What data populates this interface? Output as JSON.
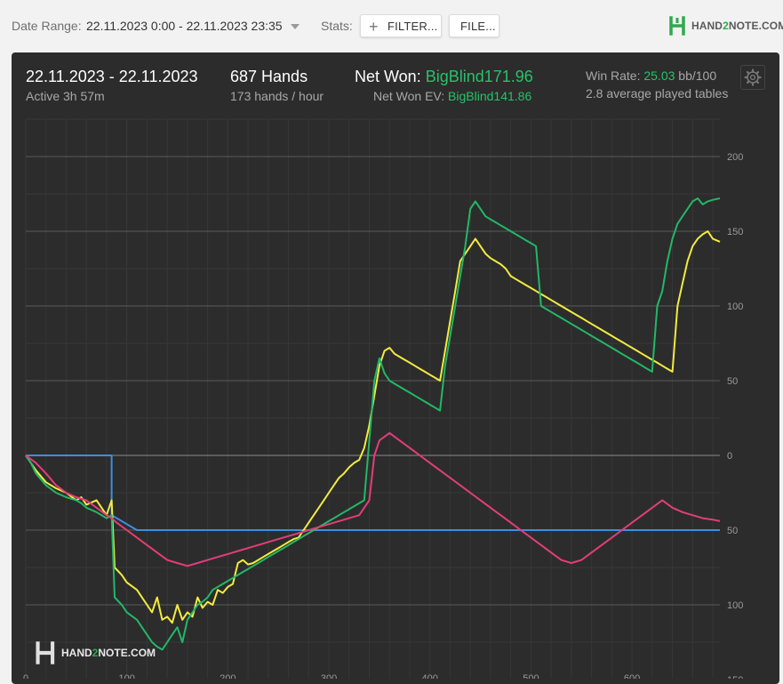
{
  "toolbar": {
    "date_range_label": "Date Range:",
    "date_range_value": "22.11.2023 0:00 - 22.11.2023 23:35",
    "stats_label": "Stats:",
    "filter_button": "FILTER...",
    "file_button": "FILE...",
    "logo_pre": "HAND",
    "logo_num": "2",
    "logo_post": "NOTE.COM"
  },
  "summary": {
    "date": "22.11.2023 - 22.11.2023",
    "active": "Active 3h 57m",
    "hands": "687 Hands",
    "hands_per_hour": "173 hands / hour",
    "net_won_label": "Net Won:",
    "net_won_value": "BigBlind171.96",
    "net_won_ev_label": "Net Won  EV:",
    "net_won_ev_value": "BigBlind141.86",
    "win_rate_label": "Win Rate:",
    "win_rate_value": "25.03",
    "win_rate_unit": "bb/100",
    "avg_tables": "2.8 average played tables"
  },
  "colors": {
    "blue": "#3d8ee0",
    "yellow": "#f2ec40",
    "green": "#22b868",
    "pink": "#e23e78",
    "panel_bg": "#2c2c2c",
    "accent_green": "#27c267"
  },
  "watermark": {
    "pre": "HAND",
    "num": "2",
    "post": "NOTE.COM"
  },
  "chart_data": {
    "type": "line",
    "x_ticks": [
      0,
      100,
      200,
      300,
      400,
      500,
      600
    ],
    "y_ticks": [
      200,
      150,
      100,
      50,
      0,
      -50,
      -100,
      -150
    ],
    "y_tick_labels": [
      "200",
      "150",
      "100",
      "50",
      "0",
      "50",
      "100",
      "150"
    ],
    "xlim": [
      0,
      687
    ],
    "ylim": [
      -150,
      225
    ],
    "grid": true,
    "series": [
      {
        "color": "#3d8ee0",
        "x": [
          0,
          85,
          85,
          110,
          110,
          155,
          155,
          190,
          190,
          210,
          210,
          236,
          236,
          272,
          272,
          295,
          296,
          305,
          305,
          330,
          330,
          343,
          345,
          350,
          350,
          360,
          360,
          400,
          400,
          412,
          412,
          420,
          420,
          448,
          455,
          455,
          460,
          460,
          475,
          480,
          480,
          495,
          495,
          500,
          510,
          510,
          580,
          585,
          585,
          600,
          600,
          615,
          615,
          625,
          625,
          665,
          665,
          675,
          675,
          687
        ],
        "y": [
          0,
          0,
          -40,
          -50,
          -50,
          -50,
          -50,
          -50,
          -50,
          -50,
          -50,
          -50,
          -50,
          -50,
          -50,
          -50,
          -50,
          -50,
          -50,
          -50,
          -50,
          -50,
          -50,
          -50,
          -50,
          -50,
          -50,
          -50,
          -50,
          -50,
          -50,
          -50,
          -50,
          -50,
          -50,
          -50,
          -50,
          -50,
          -50,
          -50,
          -50,
          -50,
          -50,
          -50,
          -50,
          -50,
          -50,
          -50,
          -50,
          -50,
          -50,
          -50,
          -50,
          -50,
          -50,
          -50,
          -50,
          -50,
          -50,
          -50
        ]
      },
      {
        "color": "#f2ec40",
        "x": [
          0,
          5,
          10,
          20,
          30,
          40,
          50,
          55,
          60,
          70,
          80,
          85,
          88,
          95,
          100,
          110,
          115,
          120,
          125,
          130,
          135,
          140,
          145,
          150,
          155,
          160,
          165,
          170,
          175,
          180,
          185,
          190,
          195,
          200,
          205,
          210,
          215,
          220,
          225,
          230,
          235,
          240,
          245,
          250,
          255,
          260,
          265,
          270,
          275,
          280,
          285,
          290,
          295,
          300,
          305,
          310,
          315,
          320,
          325,
          330,
          335,
          340,
          345,
          350,
          355,
          360,
          365,
          370,
          375,
          380,
          385,
          390,
          395,
          400,
          405,
          410,
          415,
          420,
          425,
          430,
          435,
          440,
          445,
          450,
          455,
          460,
          465,
          470,
          475,
          480,
          485,
          490,
          495,
          500,
          505,
          510,
          515,
          520,
          525,
          530,
          535,
          540,
          545,
          550,
          555,
          560,
          565,
          570,
          575,
          580,
          585,
          590,
          595,
          600,
          605,
          610,
          615,
          620,
          625,
          630,
          635,
          640,
          645,
          650,
          655,
          660,
          665,
          670,
          675,
          680,
          687
        ],
        "y": [
          0,
          -5,
          -10,
          -18,
          -22,
          -25,
          -30,
          -28,
          -33,
          -30,
          -40,
          -30,
          -75,
          -80,
          -85,
          -90,
          -95,
          -100,
          -105,
          -95,
          -110,
          -108,
          -112,
          -100,
          -110,
          -105,
          -108,
          -95,
          -102,
          -98,
          -100,
          -90,
          -92,
          -88,
          -86,
          -72,
          -70,
          -73,
          -72,
          -70,
          -68,
          -66,
          -64,
          -62,
          -60,
          -58,
          -56,
          -55,
          -50,
          -45,
          -40,
          -35,
          -30,
          -25,
          -20,
          -15,
          -12,
          -8,
          -5,
          -3,
          5,
          20,
          40,
          60,
          70,
          72,
          68,
          66,
          64,
          62,
          60,
          58,
          56,
          54,
          52,
          50,
          70,
          90,
          110,
          130,
          135,
          140,
          145,
          140,
          135,
          132,
          130,
          128,
          125,
          120,
          118,
          116,
          114,
          112,
          110,
          108,
          106,
          104,
          102,
          100,
          98,
          96,
          94,
          92,
          90,
          88,
          86,
          84,
          82,
          80,
          78,
          76,
          74,
          72,
          70,
          68,
          66,
          64,
          62,
          60,
          58,
          56,
          100,
          115,
          130,
          140,
          145,
          148,
          150,
          145,
          143
        ]
      },
      {
        "color": "#22b868",
        "x": [
          0,
          5,
          10,
          20,
          30,
          40,
          50,
          55,
          60,
          70,
          80,
          85,
          88,
          95,
          100,
          110,
          115,
          120,
          125,
          130,
          135,
          140,
          145,
          150,
          155,
          160,
          165,
          170,
          175,
          180,
          185,
          190,
          195,
          200,
          205,
          210,
          215,
          220,
          225,
          230,
          235,
          240,
          245,
          250,
          255,
          260,
          265,
          270,
          275,
          280,
          285,
          290,
          295,
          300,
          305,
          310,
          315,
          320,
          325,
          330,
          335,
          340,
          345,
          350,
          355,
          360,
          365,
          370,
          375,
          380,
          385,
          390,
          395,
          400,
          405,
          410,
          415,
          420,
          425,
          430,
          435,
          440,
          445,
          450,
          455,
          460,
          465,
          470,
          475,
          480,
          485,
          490,
          495,
          500,
          505,
          510,
          515,
          520,
          525,
          530,
          535,
          540,
          545,
          550,
          555,
          560,
          565,
          570,
          575,
          580,
          585,
          590,
          595,
          600,
          605,
          610,
          615,
          620,
          625,
          630,
          635,
          640,
          645,
          650,
          655,
          660,
          665,
          670,
          675,
          680,
          687
        ],
        "y": [
          0,
          -5,
          -12,
          -20,
          -25,
          -28,
          -30,
          -32,
          -35,
          -38,
          -42,
          -40,
          -95,
          -100,
          -105,
          -110,
          -115,
          -120,
          -125,
          -128,
          -130,
          -125,
          -120,
          -115,
          -125,
          -110,
          -105,
          -100,
          -98,
          -95,
          -90,
          -88,
          -86,
          -84,
          -82,
          -80,
          -78,
          -76,
          -74,
          -72,
          -70,
          -68,
          -66,
          -64,
          -62,
          -60,
          -58,
          -56,
          -54,
          -52,
          -50,
          -48,
          -46,
          -44,
          -42,
          -40,
          -38,
          -36,
          -34,
          -32,
          -30,
          10,
          50,
          65,
          55,
          50,
          48,
          46,
          44,
          42,
          40,
          38,
          36,
          34,
          32,
          30,
          60,
          80,
          100,
          120,
          140,
          165,
          170,
          165,
          160,
          158,
          156,
          154,
          152,
          150,
          148,
          146,
          144,
          142,
          140,
          100,
          98,
          96,
          94,
          92,
          90,
          88,
          86,
          84,
          82,
          80,
          78,
          76,
          74,
          72,
          70,
          68,
          66,
          64,
          62,
          60,
          58,
          56,
          100,
          110,
          130,
          145,
          155,
          160,
          165,
          170,
          172,
          168,
          170,
          171,
          172
        ]
      },
      {
        "color": "#e23e78",
        "x": [
          0,
          10,
          20,
          30,
          40,
          50,
          60,
          70,
          80,
          85,
          90,
          100,
          110,
          120,
          130,
          140,
          150,
          160,
          170,
          180,
          190,
          200,
          210,
          220,
          230,
          240,
          250,
          260,
          270,
          280,
          290,
          300,
          310,
          320,
          330,
          340,
          345,
          350,
          360,
          370,
          380,
          390,
          400,
          410,
          420,
          430,
          440,
          450,
          460,
          470,
          480,
          490,
          500,
          510,
          520,
          530,
          540,
          550,
          560,
          570,
          580,
          590,
          600,
          610,
          620,
          630,
          640,
          650,
          660,
          670,
          680,
          687
        ],
        "y": [
          0,
          -5,
          -12,
          -20,
          -25,
          -28,
          -30,
          -35,
          -40,
          -42,
          -45,
          -50,
          -55,
          -60,
          -65,
          -70,
          -72,
          -74,
          -72,
          -70,
          -68,
          -66,
          -64,
          -62,
          -60,
          -58,
          -56,
          -54,
          -52,
          -50,
          -48,
          -46,
          -44,
          -42,
          -40,
          -30,
          0,
          10,
          15,
          10,
          5,
          0,
          -5,
          -10,
          -15,
          -20,
          -25,
          -30,
          -35,
          -40,
          -45,
          -50,
          -55,
          -60,
          -65,
          -70,
          -72,
          -70,
          -65,
          -60,
          -55,
          -50,
          -45,
          -40,
          -35,
          -30,
          -35,
          -38,
          -40,
          -42,
          -43,
          -44
        ]
      }
    ]
  }
}
